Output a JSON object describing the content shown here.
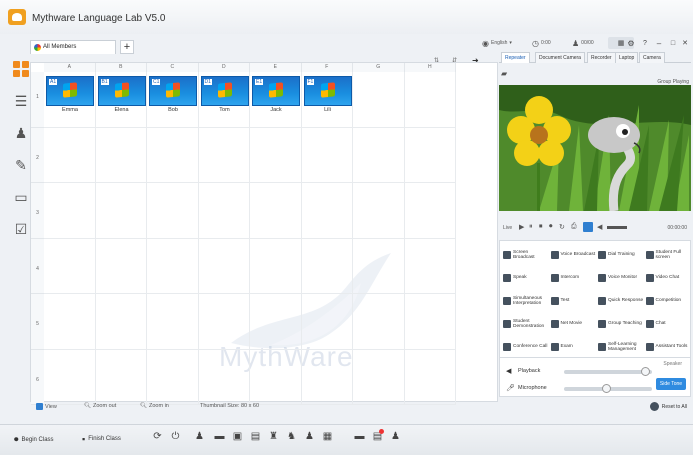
{
  "app": {
    "title": "Mythware Language Lab V5.0"
  },
  "titlebar": {
    "language": "English",
    "language_arrow": "▾",
    "clock": "0:00",
    "users": "00/00",
    "time": "00:00"
  },
  "tabs": [
    {
      "label": "All Members"
    }
  ],
  "grid": {
    "columns": [
      "A",
      "B",
      "C",
      "D",
      "E",
      "F",
      "G",
      "H"
    ],
    "rows": [
      "1",
      "2",
      "3",
      "4",
      "5",
      "6"
    ]
  },
  "students": [
    {
      "seat": "A1",
      "name": "Emma"
    },
    {
      "seat": "B1",
      "name": "Elena"
    },
    {
      "seat": "C1",
      "name": "Bob"
    },
    {
      "seat": "D1",
      "name": "Tom"
    },
    {
      "seat": "E1",
      "name": "Jack"
    },
    {
      "seat": "F1",
      "name": "Lili"
    }
  ],
  "watermark": {
    "text": "MythWare"
  },
  "statusbar": {
    "view": "View",
    "zoom_out": "Zoom out",
    "zoom_in": "Zoom in",
    "thumbnail_size": "Thumbnail Size: 80 x 60"
  },
  "bottombar": {
    "begin_class": "Begin Class",
    "finish_class": "Finish Class"
  },
  "right_panel": {
    "tabs": [
      "Repeater",
      "Document Camera",
      "Recorder",
      "Laptop",
      "Camera"
    ],
    "group_playing": "Group Playing",
    "player_label": "Live",
    "player_time": "00:00:00",
    "functions": [
      [
        "Screen Broadcast",
        "Voice Broadcast",
        "Dial Training",
        "Student Full screen"
      ],
      [
        "Speak",
        "Intercom",
        "Voice Monitor",
        "Video Chat"
      ],
      [
        "Simultaneous Interpretation",
        "Test",
        "Quick Response",
        "Competition"
      ],
      [
        "Student Demonstration",
        "Net Movie",
        "Group Teaching",
        "Chat"
      ],
      [
        "Conference Call",
        "Exam",
        "Self-Learning Management",
        "Assistant Tools"
      ]
    ],
    "audio": {
      "speaker": "Speaker",
      "playback": "Playback",
      "microphone": "Microphone",
      "side_tone": "Side Tone",
      "playback_level": 0.92,
      "microphone_level": 0.48
    },
    "reset_all": "Reset to All"
  }
}
